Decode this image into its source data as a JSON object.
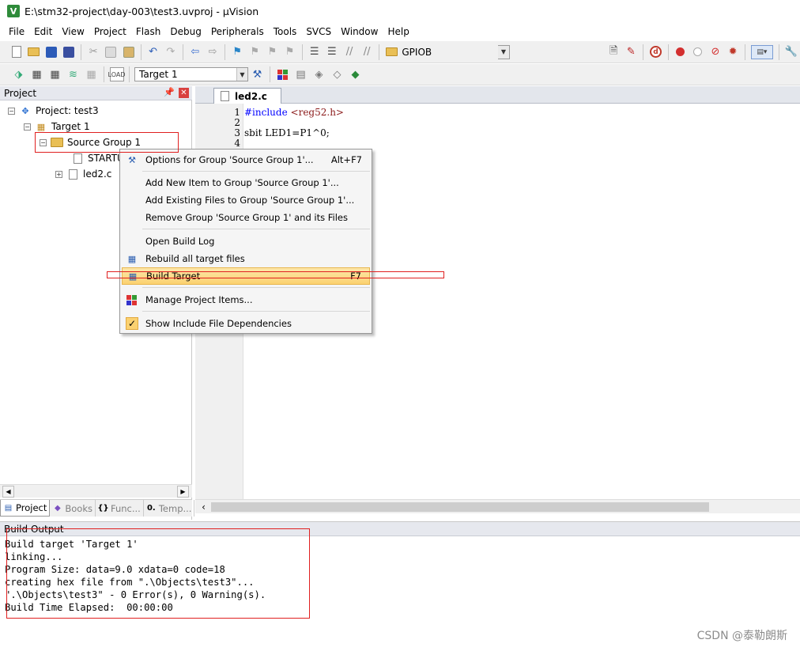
{
  "window": {
    "title": "E:\\stm32-project\\day-003\\test3.uvproj - µVision"
  },
  "menu": [
    "File",
    "Edit",
    "View",
    "Project",
    "Flash",
    "Debug",
    "Peripherals",
    "Tools",
    "SVCS",
    "Window",
    "Help"
  ],
  "toolbar": {
    "find_combo_value": "GPIOB",
    "target_combo_value": "Target 1"
  },
  "project_panel": {
    "title": "Project",
    "tree": {
      "project": "Project: test3",
      "target": "Target 1",
      "group": "Source Group 1",
      "files": [
        "STARTUP",
        "led2.c"
      ]
    },
    "tabs": [
      "Project",
      "Books",
      "Func...",
      "Temp..."
    ]
  },
  "editor": {
    "tab": "led2.c",
    "line_numbers": [
      "1",
      "2",
      "3",
      "4"
    ],
    "code": {
      "line1_directive": "#include",
      "line1_header": "<reg52.h>",
      "line3": "sbit LED1=P1^0;"
    }
  },
  "context_menu": {
    "options": {
      "label": "Options for Group 'Source Group 1'...",
      "shortcut": "Alt+F7"
    },
    "add_new": "Add New  Item to Group 'Source Group 1'...",
    "add_existing": "Add Existing Files to Group 'Source Group 1'...",
    "remove": "Remove Group 'Source Group 1' and its Files",
    "open_build_log": "Open Build Log",
    "rebuild": "Rebuild all target files",
    "build": {
      "label": "Build Target",
      "shortcut": "F7"
    },
    "manage": "Manage Project Items...",
    "show_deps": "Show Include File Dependencies"
  },
  "build_output": {
    "title": "Build Output",
    "lines": [
      "Build target 'Target 1'",
      "linking...",
      "Program Size: data=9.0 xdata=0 code=18",
      "creating hex file from \".\\Objects\\test3\"...",
      "\".\\Objects\\test3\" - 0 Error(s), 0 Warning(s).",
      "Build Time Elapsed:  00:00:00"
    ]
  },
  "watermark": "CSDN @泰勒朗斯",
  "colors": {
    "annotation_red": "#e02020",
    "highlight": "#fbd170",
    "keyword_blue": "#0000ff"
  }
}
